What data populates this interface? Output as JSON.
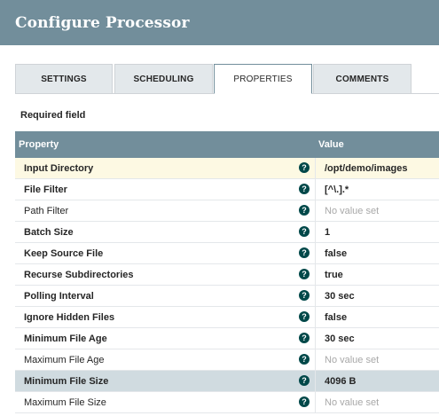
{
  "dialog": {
    "title": "Configure Processor"
  },
  "tabs": [
    {
      "label": "SETTINGS"
    },
    {
      "label": "SCHEDULING"
    },
    {
      "label": "PROPERTIES"
    },
    {
      "label": "COMMENTS"
    }
  ],
  "active_tab": "PROPERTIES",
  "required_label": "Required field",
  "grid": {
    "headers": {
      "property": "Property",
      "value": "Value"
    },
    "rows": [
      {
        "name": "Input Directory",
        "value": "/opt/demo/images",
        "required": true
      },
      {
        "name": "File Filter",
        "value": "[^\\.].*",
        "required": true
      },
      {
        "name": "Path Filter",
        "value": "No value set",
        "required": false
      },
      {
        "name": "Batch Size",
        "value": "1",
        "required": true
      },
      {
        "name": "Keep Source File",
        "value": "false",
        "required": true
      },
      {
        "name": "Recurse Subdirectories",
        "value": "true",
        "required": true
      },
      {
        "name": "Polling Interval",
        "value": "30 sec",
        "required": true
      },
      {
        "name": "Ignore Hidden Files",
        "value": "false",
        "required": true
      },
      {
        "name": "Minimum File Age",
        "value": "30 sec",
        "required": true
      },
      {
        "name": "Maximum File Age",
        "value": "No value set",
        "required": false
      },
      {
        "name": "Minimum File Size",
        "value": "4096 B",
        "required": true
      },
      {
        "name": "Maximum File Size",
        "value": "No value set",
        "required": false
      }
    ],
    "help_icon": "question-circle-icon"
  },
  "colors": {
    "header": "#728e9b",
    "highlight_row": "#fdf9e3",
    "selected_row": "#d0dbe0",
    "help_icon": "#004849"
  }
}
